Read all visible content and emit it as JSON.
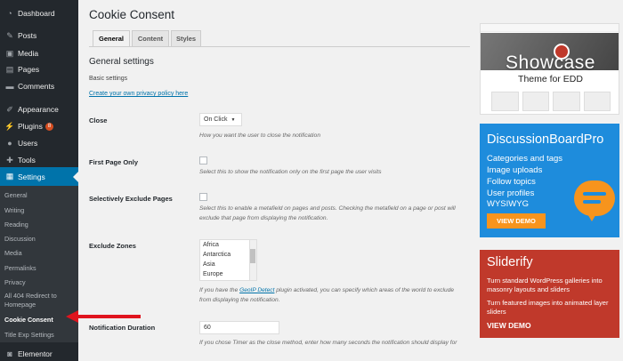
{
  "sidebar": {
    "items": [
      {
        "label": "Dashboard",
        "icon": "dashboard-icon"
      },
      {
        "label": "Posts",
        "icon": "pin-icon"
      },
      {
        "label": "Media",
        "icon": "media-icon"
      },
      {
        "label": "Pages",
        "icon": "pages-icon"
      },
      {
        "label": "Comments",
        "icon": "comments-icon"
      },
      {
        "label": "Appearance",
        "icon": "brush-icon"
      },
      {
        "label": "Plugins",
        "icon": "plug-icon",
        "badge": "8"
      },
      {
        "label": "Users",
        "icon": "users-icon"
      },
      {
        "label": "Tools",
        "icon": "wrench-icon"
      },
      {
        "label": "Settings",
        "icon": "settings-icon"
      },
      {
        "label": "Elementor",
        "icon": "elementor-icon"
      }
    ],
    "submenu": [
      "General",
      "Writing",
      "Reading",
      "Discussion",
      "Media",
      "Permalinks",
      "Privacy",
      "All 404 Redirect to",
      "Homepage",
      "Cookie Consent",
      "Title Exp Settings"
    ]
  },
  "main": {
    "title": "Cookie Consent",
    "tabs": [
      "General",
      "Content",
      "Styles"
    ],
    "section_title": "General settings",
    "basic_settings": "Basic settings",
    "privacy_link": "Create your own privacy policy here",
    "fields": {
      "close": {
        "label": "Close",
        "value": "On Click",
        "desc": "How you want the user to close the notification"
      },
      "first_page": {
        "label": "First Page Only",
        "desc": "Select this to show the notification only on the first page the user visits"
      },
      "exclude_pages": {
        "label": "Selectively Exclude Pages",
        "desc": "Select this to enable a metafield on pages and posts. Checking the metafield on a page or post will exclude that page from displaying the notification."
      },
      "exclude_zones": {
        "label": "Exclude Zones",
        "options": [
          "Africa",
          "Antarctica",
          "Asia",
          "Europe"
        ],
        "desc_before": "If you have the ",
        "desc_link": "GeoIP Detect",
        "desc_after": " plugin activated, you can specify which areas of the world to exclude from displaying the notification."
      },
      "duration": {
        "label": "Notification Duration",
        "value": "60",
        "desc": "If you chose Timer as the close method, enter how many seconds the notification should display for"
      }
    }
  },
  "ads": {
    "showcase": {
      "title": "Showcase",
      "subtitle": "Theme for EDD"
    },
    "dbp": {
      "title": "DiscussionBoardPro",
      "features": [
        "Categories and tags",
        "Image uploads",
        "Follow topics",
        "User profiles",
        "WYSIWYG"
      ],
      "button": "VIEW DEMO"
    },
    "sliderify": {
      "title": "Sliderify",
      "line1": "Turn standard WordPress galleries into masonry layouts and sliders",
      "line2": "Turn featured images into animated layer sliders",
      "button": "VIEW DEMO"
    }
  },
  "colors": {
    "sidebar_bg": "#23282d",
    "submenu_bg": "#32373c",
    "active_blue": "#0073aa",
    "dbp_blue": "#1e8cdc",
    "dbp_orange": "#f7941d",
    "sliderify_red": "#c0392b",
    "annotation_red": "#e0141e"
  }
}
